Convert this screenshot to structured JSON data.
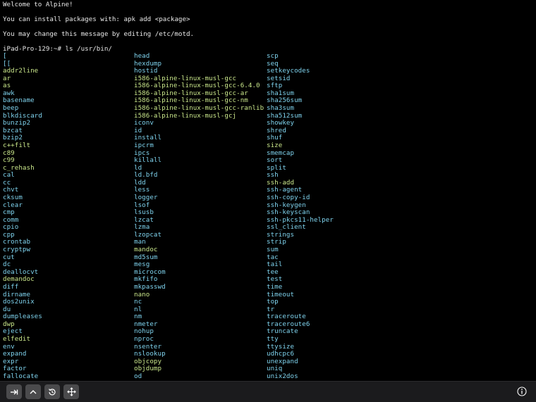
{
  "terminal": {
    "motd": [
      "Welcome to Alpine!",
      "You can install packages with: apk add <package>",
      "You may change this message by editing /etc/motd."
    ],
    "prompt": "iPad-Pro-129:~# ls /usr/bin/",
    "listing": {
      "col1": [
        {
          "name": "[",
          "color": "cyan"
        },
        {
          "name": "[[",
          "color": "cyan"
        },
        {
          "name": "addr2line",
          "color": "green"
        },
        {
          "name": "ar",
          "color": "green"
        },
        {
          "name": "as",
          "color": "green"
        },
        {
          "name": "awk",
          "color": "cyan"
        },
        {
          "name": "basename",
          "color": "cyan"
        },
        {
          "name": "beep",
          "color": "cyan"
        },
        {
          "name": "blkdiscard",
          "color": "cyan"
        },
        {
          "name": "bunzip2",
          "color": "cyan"
        },
        {
          "name": "bzcat",
          "color": "cyan"
        },
        {
          "name": "bzip2",
          "color": "cyan"
        },
        {
          "name": "c++filt",
          "color": "green"
        },
        {
          "name": "c89",
          "color": "green"
        },
        {
          "name": "c99",
          "color": "green"
        },
        {
          "name": "c_rehash",
          "color": "green"
        },
        {
          "name": "cal",
          "color": "cyan"
        },
        {
          "name": "cc",
          "color": "cyan"
        },
        {
          "name": "chvt",
          "color": "cyan"
        },
        {
          "name": "cksum",
          "color": "cyan"
        },
        {
          "name": "clear",
          "color": "cyan"
        },
        {
          "name": "cmp",
          "color": "cyan"
        },
        {
          "name": "comm",
          "color": "cyan"
        },
        {
          "name": "cpio",
          "color": "cyan"
        },
        {
          "name": "cpp",
          "color": "cyan"
        },
        {
          "name": "crontab",
          "color": "cyan"
        },
        {
          "name": "cryptpw",
          "color": "cyan"
        },
        {
          "name": "cut",
          "color": "cyan"
        },
        {
          "name": "dc",
          "color": "cyan"
        },
        {
          "name": "deallocvt",
          "color": "cyan"
        },
        {
          "name": "demandoc",
          "color": "green"
        },
        {
          "name": "diff",
          "color": "cyan"
        },
        {
          "name": "dirname",
          "color": "cyan"
        },
        {
          "name": "dos2unix",
          "color": "cyan"
        },
        {
          "name": "du",
          "color": "cyan"
        },
        {
          "name": "dumpleases",
          "color": "cyan"
        },
        {
          "name": "dwp",
          "color": "green"
        },
        {
          "name": "eject",
          "color": "cyan"
        },
        {
          "name": "elfedit",
          "color": "green"
        },
        {
          "name": "env",
          "color": "cyan"
        },
        {
          "name": "expand",
          "color": "cyan"
        },
        {
          "name": "expr",
          "color": "cyan"
        },
        {
          "name": "factor",
          "color": "cyan"
        },
        {
          "name": "fallocate",
          "color": "cyan"
        }
      ],
      "col2": [
        {
          "name": "head",
          "color": "cyan"
        },
        {
          "name": "hexdump",
          "color": "cyan"
        },
        {
          "name": "hostid",
          "color": "cyan"
        },
        {
          "name": "i586-alpine-linux-musl-gcc",
          "color": "green"
        },
        {
          "name": "i586-alpine-linux-musl-gcc-6.4.0",
          "color": "green"
        },
        {
          "name": "i586-alpine-linux-musl-gcc-ar",
          "color": "green"
        },
        {
          "name": "i586-alpine-linux-musl-gcc-nm",
          "color": "green"
        },
        {
          "name": "i586-alpine-linux-musl-gcc-ranlib",
          "color": "green"
        },
        {
          "name": "i586-alpine-linux-musl-gcj",
          "color": "green"
        },
        {
          "name": "iconv",
          "color": "cyan"
        },
        {
          "name": "id",
          "color": "cyan"
        },
        {
          "name": "install",
          "color": "cyan"
        },
        {
          "name": "ipcrm",
          "color": "cyan"
        },
        {
          "name": "ipcs",
          "color": "cyan"
        },
        {
          "name": "killall",
          "color": "cyan"
        },
        {
          "name": "ld",
          "color": "cyan"
        },
        {
          "name": "ld.bfd",
          "color": "cyan"
        },
        {
          "name": "ldd",
          "color": "cyan"
        },
        {
          "name": "less",
          "color": "cyan"
        },
        {
          "name": "logger",
          "color": "cyan"
        },
        {
          "name": "lsof",
          "color": "cyan"
        },
        {
          "name": "lsusb",
          "color": "cyan"
        },
        {
          "name": "lzcat",
          "color": "cyan"
        },
        {
          "name": "lzma",
          "color": "cyan"
        },
        {
          "name": "lzopcat",
          "color": "cyan"
        },
        {
          "name": "man",
          "color": "cyan"
        },
        {
          "name": "mandoc",
          "color": "green"
        },
        {
          "name": "md5sum",
          "color": "cyan"
        },
        {
          "name": "mesg",
          "color": "cyan"
        },
        {
          "name": "microcom",
          "color": "cyan"
        },
        {
          "name": "mkfifo",
          "color": "cyan"
        },
        {
          "name": "mkpasswd",
          "color": "cyan"
        },
        {
          "name": "nano",
          "color": "green"
        },
        {
          "name": "nc",
          "color": "cyan"
        },
        {
          "name": "nl",
          "color": "cyan"
        },
        {
          "name": "nm",
          "color": "cyan"
        },
        {
          "name": "nmeter",
          "color": "cyan"
        },
        {
          "name": "nohup",
          "color": "cyan"
        },
        {
          "name": "nproc",
          "color": "cyan"
        },
        {
          "name": "nsenter",
          "color": "cyan"
        },
        {
          "name": "nslookup",
          "color": "cyan"
        },
        {
          "name": "objcopy",
          "color": "green"
        },
        {
          "name": "objdump",
          "color": "green"
        },
        {
          "name": "od",
          "color": "cyan"
        }
      ],
      "col3": [
        {
          "name": "scp",
          "color": "cyan"
        },
        {
          "name": "seq",
          "color": "cyan"
        },
        {
          "name": "setkeycodes",
          "color": "cyan"
        },
        {
          "name": "setsid",
          "color": "cyan"
        },
        {
          "name": "sftp",
          "color": "cyan"
        },
        {
          "name": "sha1sum",
          "color": "cyan"
        },
        {
          "name": "sha256sum",
          "color": "cyan"
        },
        {
          "name": "sha3sum",
          "color": "cyan"
        },
        {
          "name": "sha512sum",
          "color": "cyan"
        },
        {
          "name": "showkey",
          "color": "cyan"
        },
        {
          "name": "shred",
          "color": "cyan"
        },
        {
          "name": "shuf",
          "color": "cyan"
        },
        {
          "name": "size",
          "color": "green"
        },
        {
          "name": "smemcap",
          "color": "cyan"
        },
        {
          "name": "sort",
          "color": "cyan"
        },
        {
          "name": "split",
          "color": "cyan"
        },
        {
          "name": "ssh",
          "color": "cyan"
        },
        {
          "name": "ssh-add",
          "color": "green"
        },
        {
          "name": "ssh-agent",
          "color": "cyan"
        },
        {
          "name": "ssh-copy-id",
          "color": "cyan"
        },
        {
          "name": "ssh-keygen",
          "color": "cyan"
        },
        {
          "name": "ssh-keyscan",
          "color": "cyan"
        },
        {
          "name": "ssh-pkcs11-helper",
          "color": "cyan"
        },
        {
          "name": "ssl_client",
          "color": "cyan"
        },
        {
          "name": "strings",
          "color": "cyan"
        },
        {
          "name": "strip",
          "color": "cyan"
        },
        {
          "name": "sum",
          "color": "cyan"
        },
        {
          "name": "tac",
          "color": "cyan"
        },
        {
          "name": "tail",
          "color": "cyan"
        },
        {
          "name": "tee",
          "color": "cyan"
        },
        {
          "name": "test",
          "color": "cyan"
        },
        {
          "name": "time",
          "color": "cyan"
        },
        {
          "name": "timeout",
          "color": "cyan"
        },
        {
          "name": "top",
          "color": "cyan"
        },
        {
          "name": "tr",
          "color": "cyan"
        },
        {
          "name": "traceroute",
          "color": "cyan"
        },
        {
          "name": "traceroute6",
          "color": "cyan"
        },
        {
          "name": "truncate",
          "color": "cyan"
        },
        {
          "name": "tty",
          "color": "cyan"
        },
        {
          "name": "ttysize",
          "color": "cyan"
        },
        {
          "name": "udhcpc6",
          "color": "cyan"
        },
        {
          "name": "unexpand",
          "color": "cyan"
        },
        {
          "name": "uniq",
          "color": "cyan"
        },
        {
          "name": "unix2dos",
          "color": "cyan"
        }
      ]
    }
  },
  "toolbar": {
    "buttons": [
      {
        "icon": "tab-key-icon"
      },
      {
        "icon": "control-key-icon"
      },
      {
        "icon": "history-icon"
      },
      {
        "icon": "move-cursor-icon"
      }
    ],
    "info_icon": "info-icon"
  },
  "colors": {
    "background": "#000000",
    "text": "#e8e8e8",
    "cyan": "#7fd3ee",
    "green": "#c9e68a",
    "toolbar": "#1b1b1d",
    "button": "#4a4a4c"
  }
}
